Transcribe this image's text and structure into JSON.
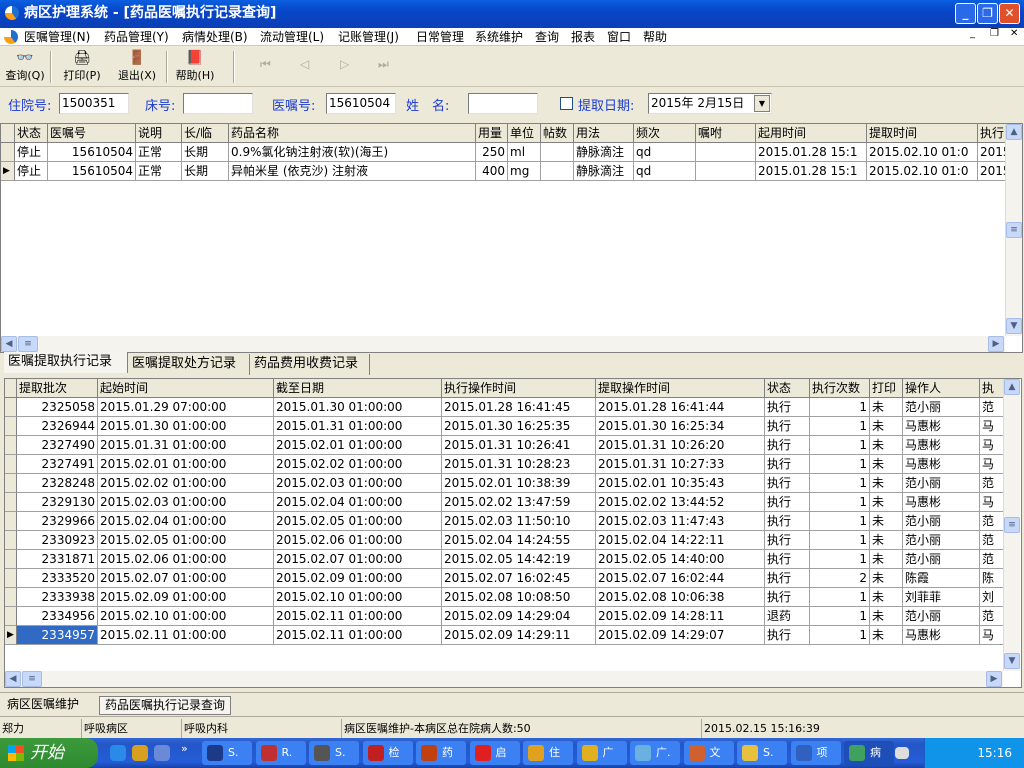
{
  "window": {
    "title": "病区护理系统 - [药品医嘱执行记录查询]"
  },
  "menu": [
    "医嘱管理(N)",
    "药品管理(Y)",
    "病情处理(B)",
    "流动管理(L)",
    "记账管理(J)",
    "日常管理",
    "系统维护",
    "查询",
    "报表",
    "窗口",
    "帮助"
  ],
  "toolbar": {
    "query": "查询(Q)",
    "print": "打印(P)",
    "exit": "退出(X)",
    "help": "帮助(H)"
  },
  "filters": {
    "admission_label": "住院号:",
    "admission_value": "1500351",
    "bed_label": "床号:",
    "bed_value": "",
    "order_label": "医嘱号:",
    "order_value": "15610504",
    "name_label": "姓　名:",
    "name_value": "",
    "date_label": "提取日期:",
    "date_value": "2015年 2月15日",
    "date_checked": false
  },
  "orders": {
    "columns": [
      "状态",
      "医嘱号",
      "说明",
      "长/临",
      "药品名称",
      "用量",
      "单位",
      "帖数",
      "用法",
      "频次",
      "嘱咐",
      "起用时间",
      "提取时间",
      "执行"
    ],
    "rows": [
      [
        "停止",
        "15610504",
        "正常",
        "长期",
        "0.9%氯化钠注射液(软)(海王)",
        "250",
        "ml",
        "",
        "静脉滴注",
        "qd",
        "",
        "2015.01.28 15:1",
        "2015.02.10 01:0",
        "2015"
      ],
      [
        "停止",
        "15610504",
        "正常",
        "长期",
        "异帕米星 (依克沙) 注射液",
        "400",
        "mg",
        "",
        "静脉滴注",
        "qd",
        "",
        "2015.01.28 15:1",
        "2015.02.10 01:0",
        "2015"
      ]
    ]
  },
  "tabs": [
    "医嘱提取执行记录",
    "医嘱提取处方记录",
    "药品费用收费记录"
  ],
  "records": {
    "columns": [
      "提取批次",
      "起始时间",
      "截至日期",
      "执行操作时间",
      "提取操作时间",
      "状态",
      "执行次数",
      "打印",
      "操作人",
      "执"
    ],
    "rows": [
      [
        "2325058",
        "2015.01.29 07:00:00",
        "2015.01.30 01:00:00",
        "2015.01.28 16:41:45",
        "2015.01.28 16:41:44",
        "执行",
        "1",
        "未",
        "范小丽",
        "范"
      ],
      [
        "2326944",
        "2015.01.30 01:00:00",
        "2015.01.31 01:00:00",
        "2015.01.30 16:25:35",
        "2015.01.30 16:25:34",
        "执行",
        "1",
        "未",
        "马惠彬",
        "马"
      ],
      [
        "2327490",
        "2015.01.31 01:00:00",
        "2015.02.01 01:00:00",
        "2015.01.31 10:26:41",
        "2015.01.31 10:26:20",
        "执行",
        "1",
        "未",
        "马惠彬",
        "马"
      ],
      [
        "2327491",
        "2015.02.01 01:00:00",
        "2015.02.02 01:00:00",
        "2015.01.31 10:28:23",
        "2015.01.31 10:27:33",
        "执行",
        "1",
        "未",
        "马惠彬",
        "马"
      ],
      [
        "2328248",
        "2015.02.02 01:00:00",
        "2015.02.03 01:00:00",
        "2015.02.01 10:38:39",
        "2015.02.01 10:35:43",
        "执行",
        "1",
        "未",
        "范小丽",
        "范"
      ],
      [
        "2329130",
        "2015.02.03 01:00:00",
        "2015.02.04 01:00:00",
        "2015.02.02 13:47:59",
        "2015.02.02 13:44:52",
        "执行",
        "1",
        "未",
        "马惠彬",
        "马"
      ],
      [
        "2329966",
        "2015.02.04 01:00:00",
        "2015.02.05 01:00:00",
        "2015.02.03 11:50:10",
        "2015.02.03 11:47:43",
        "执行",
        "1",
        "未",
        "范小丽",
        "范"
      ],
      [
        "2330923",
        "2015.02.05 01:00:00",
        "2015.02.06 01:00:00",
        "2015.02.04 14:24:55",
        "2015.02.04 14:22:11",
        "执行",
        "1",
        "未",
        "范小丽",
        "范"
      ],
      [
        "2331871",
        "2015.02.06 01:00:00",
        "2015.02.07 01:00:00",
        "2015.02.05 14:42:19",
        "2015.02.05 14:40:00",
        "执行",
        "1",
        "未",
        "范小丽",
        "范"
      ],
      [
        "2333520",
        "2015.02.07 01:00:00",
        "2015.02.09 01:00:00",
        "2015.02.07 16:02:45",
        "2015.02.07 16:02:44",
        "执行",
        "2",
        "未",
        "陈霞",
        "陈"
      ],
      [
        "2333938",
        "2015.02.09 01:00:00",
        "2015.02.10 01:00:00",
        "2015.02.08 10:08:50",
        "2015.02.08 10:06:38",
        "执行",
        "1",
        "未",
        "刘菲菲",
        "刘"
      ],
      [
        "2334956",
        "2015.02.10 01:00:00",
        "2015.02.11 01:00:00",
        "2015.02.09 14:29:04",
        "2015.02.09 14:28:11",
        "退药",
        "1",
        "未",
        "范小丽",
        "范"
      ],
      [
        "2334957",
        "2015.02.11 01:00:00",
        "2015.02.11 01:00:00",
        "2015.02.09 14:29:11",
        "2015.02.09 14:29:07",
        "执行",
        "1",
        "未",
        "马惠彬",
        "马"
      ]
    ]
  },
  "mdi_tabs": [
    "病区医嘱维护",
    "药品医嘱执行记录查询"
  ],
  "status": [
    "郑力",
    "呼吸病区",
    "呼吸内科",
    "病区医嘱维护-本病区总在院病人数:50",
    "2015.02.15 15:16:39"
  ],
  "taskbar": {
    "start": "开始",
    "tasks": [
      "S.",
      "R.",
      "S.",
      "检",
      "药",
      "启",
      "住",
      "广",
      "广.",
      "文",
      "S.",
      "项",
      "病"
    ],
    "clock": "15:16"
  },
  "colors": {
    "title_blue": "#0846c8",
    "label_blue": "#1b3bd0",
    "selection": "#316ac5"
  }
}
